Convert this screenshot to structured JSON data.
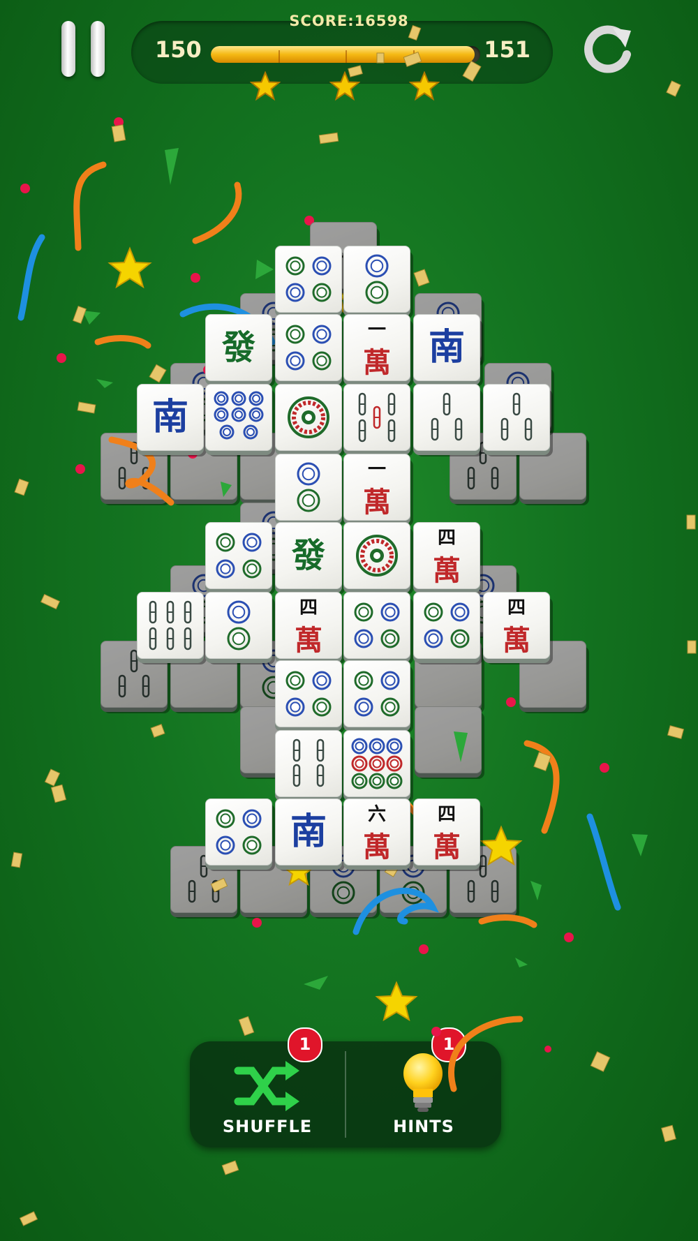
{
  "header": {
    "score_text": "SCORE:16598",
    "level_current": "150",
    "level_next": "151",
    "progress_fraction": 0.98,
    "stars_earned": 3
  },
  "tools": {
    "shuffle_label": "SHUFFLE",
    "shuffle_count": "1",
    "hints_label": "HINTS",
    "hints_count": "1"
  },
  "colors": {
    "background": "#137320",
    "wan_red": "#c0282a",
    "south_blue": "#1c3fa0",
    "fa_green": "#176b2a",
    "badge_red": "#e0152a",
    "star_gold": "#f5c800"
  },
  "tiles": [
    {
      "id": "r0-l1-1",
      "label": "一萬",
      "kind": "wan-partial",
      "layer": "low"
    },
    {
      "id": "c4a",
      "label": "",
      "kind": "circles-4",
      "layer": "top"
    },
    {
      "id": "c2a",
      "label": "",
      "kind": "circles-2",
      "layer": "top"
    },
    {
      "id": "fa1",
      "label": "發",
      "kind": "fa",
      "layer": "top"
    },
    {
      "id": "c4b",
      "label": "",
      "kind": "circles-4",
      "layer": "top"
    },
    {
      "id": "w1a",
      "num": "一",
      "label": "萬",
      "kind": "wan",
      "layer": "top"
    },
    {
      "id": "s1",
      "label": "南",
      "kind": "south",
      "layer": "top"
    },
    {
      "id": "s2",
      "label": "南",
      "kind": "south",
      "layer": "top"
    },
    {
      "id": "c8",
      "label": "",
      "kind": "circles-8",
      "layer": "top"
    },
    {
      "id": "c1a",
      "label": "",
      "kind": "circle-1",
      "layer": "top"
    },
    {
      "id": "b5",
      "label": "",
      "kind": "bamboo-5",
      "layer": "top"
    },
    {
      "id": "b3a",
      "label": "",
      "kind": "bamboo-3",
      "layer": "top"
    },
    {
      "id": "b3b",
      "label": "",
      "kind": "bamboo-3",
      "layer": "top"
    },
    {
      "id": "c2b",
      "label": "",
      "kind": "circles-2",
      "layer": "top"
    },
    {
      "id": "w1b",
      "num": "一",
      "label": "萬",
      "kind": "wan",
      "layer": "top"
    },
    {
      "id": "c4c",
      "label": "",
      "kind": "circles-4",
      "layer": "top"
    },
    {
      "id": "fa2",
      "label": "發",
      "kind": "fa",
      "layer": "top"
    },
    {
      "id": "c1b",
      "label": "",
      "kind": "circle-1",
      "layer": "top"
    },
    {
      "id": "w4a",
      "num": "四",
      "label": "萬",
      "kind": "wan",
      "layer": "top"
    },
    {
      "id": "b6",
      "label": "",
      "kind": "bamboo-6",
      "layer": "top"
    },
    {
      "id": "c2c",
      "label": "",
      "kind": "circles-2",
      "layer": "top"
    },
    {
      "id": "w4b",
      "num": "四",
      "label": "萬",
      "kind": "wan",
      "layer": "top"
    },
    {
      "id": "c4d",
      "label": "",
      "kind": "circles-4",
      "layer": "top"
    },
    {
      "id": "c4e",
      "label": "",
      "kind": "circles-4",
      "layer": "top"
    },
    {
      "id": "w4c",
      "num": "四",
      "label": "萬",
      "kind": "wan",
      "layer": "top"
    },
    {
      "id": "c4f",
      "label": "",
      "kind": "circles-4",
      "layer": "top"
    },
    {
      "id": "c4g",
      "label": "",
      "kind": "circles-4",
      "layer": "top"
    },
    {
      "id": "b4",
      "label": "",
      "kind": "bamboo-4",
      "layer": "top"
    },
    {
      "id": "c9",
      "label": "",
      "kind": "circles-9",
      "layer": "top"
    },
    {
      "id": "c4h",
      "label": "",
      "kind": "circles-4",
      "layer": "top"
    },
    {
      "id": "s3",
      "label": "南",
      "kind": "south",
      "layer": "top"
    },
    {
      "id": "w6",
      "num": "六",
      "label": "萬",
      "kind": "wan",
      "layer": "top"
    },
    {
      "id": "w4d",
      "num": "四",
      "label": "萬",
      "kind": "wan",
      "layer": "top"
    }
  ]
}
